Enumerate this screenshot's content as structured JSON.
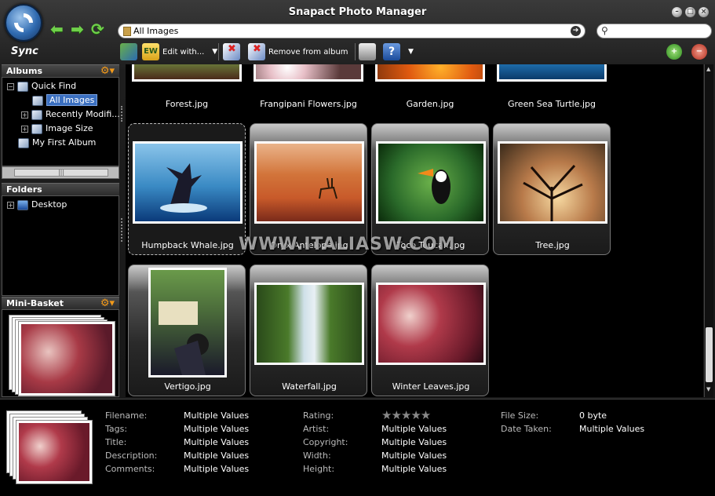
{
  "window": {
    "title": "Snapact Photo Manager",
    "sync_label": "Sync",
    "controls": [
      "minimize",
      "maximize",
      "close"
    ]
  },
  "address": {
    "path": "All Images",
    "search_placeholder": ""
  },
  "toolbar": {
    "edit_with_label": "Edit with...",
    "remove_label": "Remove from album"
  },
  "albums": {
    "header": "Albums",
    "items": [
      {
        "label": "Quick Find",
        "icon": "album-icon"
      },
      {
        "label": "All Images",
        "icon": "album-icon",
        "selected": true
      },
      {
        "label": "Recently Modifi...",
        "icon": "album-icon"
      },
      {
        "label": "Image Size",
        "icon": "album-icon"
      },
      {
        "label": "My First Album",
        "icon": "album-icon"
      }
    ]
  },
  "folders": {
    "header": "Folders",
    "items": [
      {
        "label": "Desktop",
        "icon": "desktop-icon"
      }
    ]
  },
  "mini_basket": {
    "header": "Mini-Basket"
  },
  "photos": [
    {
      "name": "Forest.jpg"
    },
    {
      "name": "Frangipani Flowers.jpg"
    },
    {
      "name": "Garden.jpg"
    },
    {
      "name": "Green Sea Turtle.jpg"
    },
    {
      "name": "Humpback Whale.jpg"
    },
    {
      "name": "Oryx Antelope.jpg"
    },
    {
      "name": "Toco Toucan.jpg"
    },
    {
      "name": "Tree.jpg"
    },
    {
      "name": "Vertigo.jpg"
    },
    {
      "name": "Waterfall.jpg"
    },
    {
      "name": "Winter Leaves.jpg"
    }
  ],
  "watermark": "WWW.ITALIASW.COM",
  "properties": {
    "col1": [
      {
        "k": "Filename:",
        "v": "Multiple Values"
      },
      {
        "k": "Tags:",
        "v": "Multiple Values"
      },
      {
        "k": "Title:",
        "v": "Multiple Values"
      },
      {
        "k": "Description:",
        "v": "Multiple Values"
      },
      {
        "k": "Comments:",
        "v": "Multiple Values"
      }
    ],
    "col2": [
      {
        "k": "Rating:",
        "v": "★★★★★"
      },
      {
        "k": "Artist:",
        "v": "Multiple Values"
      },
      {
        "k": "Copyright:",
        "v": "Multiple Values"
      },
      {
        "k": "Width:",
        "v": "Multiple Values"
      },
      {
        "k": "Height:",
        "v": "Multiple Values"
      }
    ],
    "col3": [
      {
        "k": "File Size:",
        "v": "0 byte"
      },
      {
        "k": "Date Taken:",
        "v": "Multiple Values"
      }
    ]
  },
  "colors": {
    "accent": "#3a6fc0",
    "gear": "#f39a1a",
    "arrow": "#6fd04a"
  }
}
